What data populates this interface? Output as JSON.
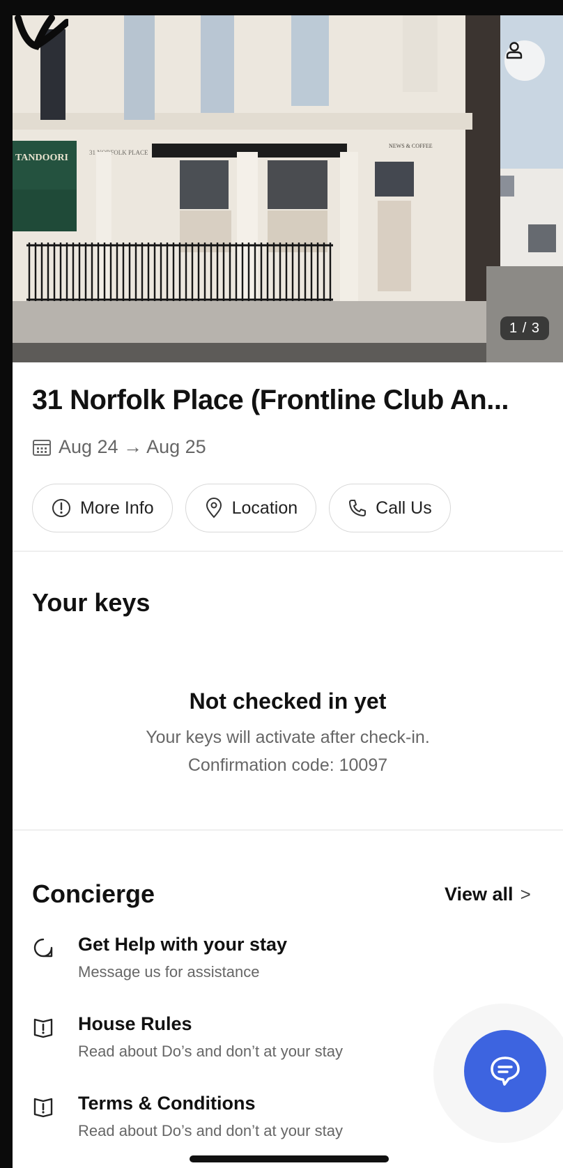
{
  "hero": {
    "photo_counter": "1 / 3",
    "sign_shop": "TANDOORI",
    "sign_street": "31 NORFOLK PLACE",
    "sign_corner": "NEWS & COFFEE",
    "profile_icon": "person-icon"
  },
  "property": {
    "title": "31 Norfolk Place (Frontline Club An...",
    "dates": "Aug 24 → Aug 25",
    "calendar_icon": "calendar-icon"
  },
  "actions": [
    {
      "label": "More Info",
      "icon": "info-icon"
    },
    {
      "label": "Location",
      "icon": "location-pin-icon"
    },
    {
      "label": "Call Us",
      "icon": "phone-icon"
    }
  ],
  "keys": {
    "heading": "Your keys",
    "status_title": "Not checked in yet",
    "status_line": "Your keys will activate after check-in.",
    "confirmation": "Confirmation code: 10097"
  },
  "concierge": {
    "heading": "Concierge",
    "view_all": "View all",
    "items": [
      {
        "title": "Get Help with your stay",
        "subtitle": "Message us for assistance",
        "icon": "chat-bubble-icon"
      },
      {
        "title": "House Rules",
        "subtitle": "Read about Do’s and don’t at your stay",
        "icon": "book-alert-icon"
      },
      {
        "title": "Terms & Conditions",
        "subtitle": "Read about Do’s and don’t at your stay",
        "icon": "book-alert-icon"
      }
    ]
  },
  "colors": {
    "accent": "#3d64e0",
    "text_primary": "#111111",
    "text_secondary": "#666666",
    "divider": "#efefef"
  }
}
